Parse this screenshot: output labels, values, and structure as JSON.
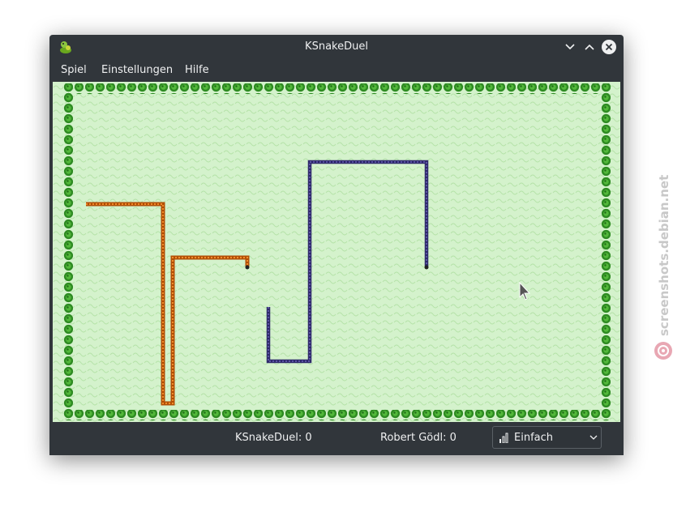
{
  "window": {
    "title": "KSnakeDuel"
  },
  "menu": {
    "items": [
      "Spiel",
      "Einstellungen",
      "Hilfe"
    ]
  },
  "status": {
    "score_computer": "KSnakeDuel: 0",
    "score_player": "Robert Gödl: 0",
    "difficulty": "Einfach"
  },
  "game": {
    "orange_snake_color": "#d9650f",
    "blue_snake_color": "#2f2a6b",
    "border_color": "#2e8b22",
    "field_color": "#d4f2cc"
  },
  "watermark": {
    "text": "screenshots.debian.net"
  }
}
